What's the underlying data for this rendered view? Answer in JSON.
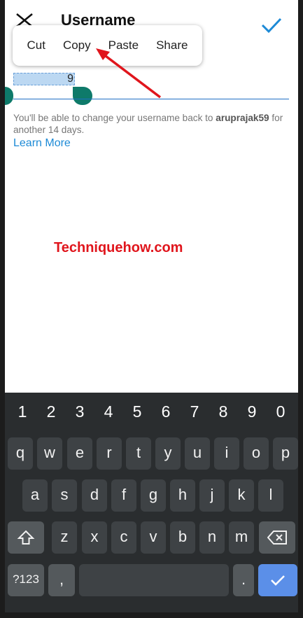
{
  "header": {
    "title": "Username"
  },
  "context_menu": {
    "items": [
      "Cut",
      "Copy",
      "Paste",
      "Share"
    ]
  },
  "username_field": {
    "selected_text": "9"
  },
  "info": {
    "text_before": "You'll be able to change your username back to ",
    "old_username": "aruprajak59",
    "text_after": " for another 14 days.",
    "learn_more": "Learn More"
  },
  "watermark": "Techniquehow.com",
  "keyboard": {
    "numbers": [
      "1",
      "2",
      "3",
      "4",
      "5",
      "6",
      "7",
      "8",
      "9",
      "0"
    ],
    "row1": [
      "q",
      "w",
      "e",
      "r",
      "t",
      "y",
      "u",
      "i",
      "o",
      "p"
    ],
    "row2": [
      "a",
      "s",
      "d",
      "f",
      "g",
      "h",
      "j",
      "k",
      "l"
    ],
    "row3": [
      "z",
      "x",
      "c",
      "v",
      "b",
      "n",
      "m"
    ],
    "symbols_key": "?123",
    "comma_key": ",",
    "period_key": "."
  },
  "colors": {
    "accent": "#1d8ad6",
    "handle": "#0e7a6a",
    "keyboard_bg": "#2a2d2f",
    "enter_key": "#5b8fe8",
    "annotation": "#e0151c"
  },
  "icons": {
    "close": "close-icon",
    "confirm": "checkmark-icon",
    "shift": "shift-icon",
    "backspace": "backspace-icon",
    "enter": "checkmark-icon"
  }
}
